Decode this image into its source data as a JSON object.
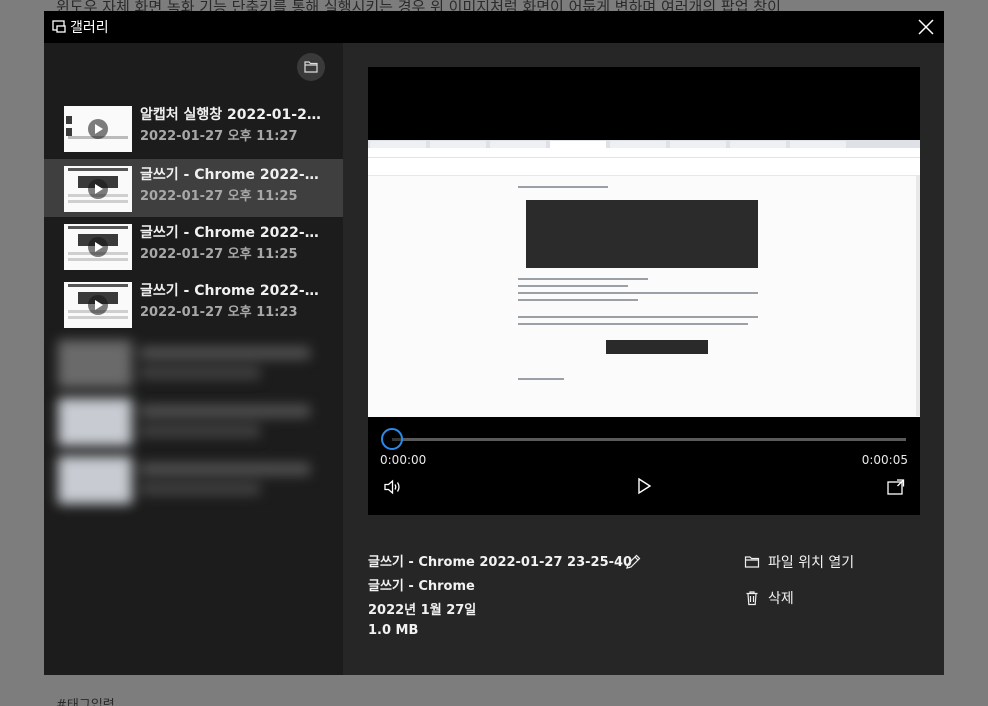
{
  "background": {
    "headline": "윈도우 자체 화면 녹화 기능 단축키를 통해 실행시키는 경우 위 이미지처럼 화면이 어둡게 변하며 여러개의 팝업 창이",
    "tag_input": "#태그입력"
  },
  "window": {
    "title": "갤러리",
    "close_icon": "close-icon",
    "title_icon": "gallery-icon"
  },
  "sidebar": {
    "folder_icon": "folder-icon",
    "items": [
      {
        "title": "알캡처 실행창 2022-01-27 2...",
        "date": "2022-01-27 오후 11:27",
        "selected": false
      },
      {
        "title": "글쓰기 - Chrome 2022-01-2...",
        "date": "2022-01-27 오후 11:25",
        "selected": true
      },
      {
        "title": "글쓰기 - Chrome 2022-01-2...",
        "date": "2022-01-27 오후 11:25",
        "selected": false
      },
      {
        "title": "글쓰기 - Chrome 2022-01-2...",
        "date": "2022-01-27 오후 11:23",
        "selected": false
      }
    ]
  },
  "player": {
    "time_current": "0:00:00",
    "time_total": "0:00:05",
    "progress": 0.0,
    "volume_icon": "speaker-icon",
    "play_icon": "play-icon",
    "fullscreen_icon": "fullscreen-icon"
  },
  "details": {
    "file_name": "글쓰기 - Chrome 2022-01-27 23-25-40",
    "app_name": "글쓰기 - Chrome",
    "date": "2022년 1월 27일",
    "size": "1.0 MB",
    "edit_icon": "pencil-icon"
  },
  "actions": {
    "open_location": "파일 위치 열기",
    "delete": "삭제"
  },
  "colors": {
    "accent": "#1e90ff",
    "titlebar": "#000000",
    "sidebar": "#1c1c1c",
    "selected": "#3f3f3f"
  }
}
